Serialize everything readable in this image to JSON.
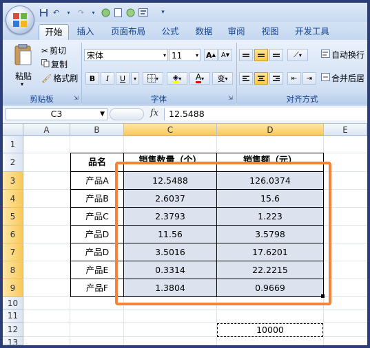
{
  "quick_access": {
    "icons": [
      "save-icon",
      "undo-icon",
      "redo-icon",
      "new-doc-icon",
      "open-icon",
      "preview-icon",
      "customize-icon"
    ]
  },
  "tabs": [
    "开始",
    "插入",
    "页面布局",
    "公式",
    "数据",
    "审阅",
    "视图",
    "开发工具"
  ],
  "ribbon": {
    "clipboard": {
      "paste": "粘贴",
      "cut": "剪切",
      "copy": "复制",
      "format_painter": "格式刷",
      "label": "剪贴板"
    },
    "font": {
      "name": "宋体",
      "size": "11",
      "grow": "A",
      "shrink": "A",
      "bold": "B",
      "italic": "I",
      "underline": "U",
      "phonetic": "变",
      "font_color_letter": "A",
      "label": "字体"
    },
    "alignment": {
      "wrap_text": "自动换行",
      "merge_center": "合并后居",
      "label": "对齐方式"
    }
  },
  "formula_bar": {
    "name_box": "C3",
    "fx_label": "fx",
    "value": "12.5488"
  },
  "columns": [
    "A",
    "B",
    "C",
    "D",
    "E"
  ],
  "rows": [
    "1",
    "2",
    "3",
    "4",
    "5",
    "6",
    "7",
    "8",
    "9",
    "10",
    "11",
    "12",
    "13"
  ],
  "table": {
    "headers": [
      "品名",
      "销售数量（个）",
      "销售额（元）"
    ],
    "rows": [
      [
        "产品A",
        "12.5488",
        "126.0374"
      ],
      [
        "产品B",
        "2.6037",
        "15.6"
      ],
      [
        "产品C",
        "2.3793",
        "1.223"
      ],
      [
        "产品D",
        "11.56",
        "3.5798"
      ],
      [
        "产品D",
        "3.5016",
        "17.6201"
      ],
      [
        "产品E",
        "0.3314",
        "22.2215"
      ],
      [
        "产品F",
        "1.3804",
        "0.9669"
      ]
    ]
  },
  "copied_cell": {
    "value": "10000"
  },
  "colors": {
    "accent_orange": "#f5833a",
    "selection": "#dde3ee",
    "ribbon": "#d3e1f4"
  }
}
